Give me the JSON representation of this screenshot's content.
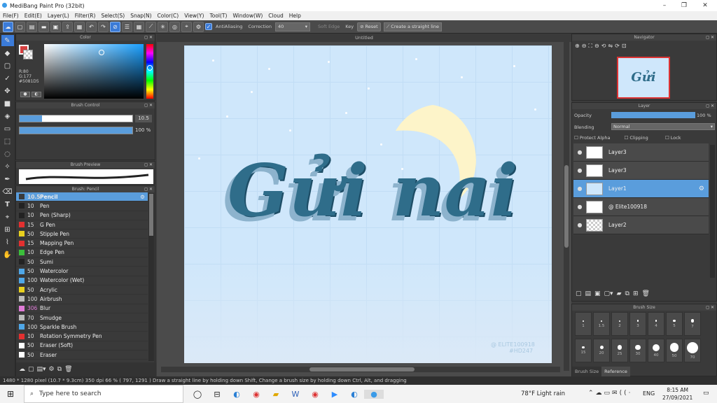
{
  "window": {
    "title": "MediBang Paint Pro (32bit)",
    "minimize": "–",
    "maximize": "❐",
    "close": "✕"
  },
  "menu": [
    "File(F)",
    "Edit(E)",
    "Layer(L)",
    "Filter(R)",
    "Select(S)",
    "Snap(N)",
    "Color(C)",
    "View(Y)",
    "Tool(T)",
    "Window(W)",
    "Cloud",
    "Help"
  ],
  "toolbar": {
    "antialiasing": "AntiAliasing",
    "correction_label": "Correction",
    "correction_value": "40",
    "soft_edge": "Soft Edge",
    "key": "Key",
    "reset": "Reset",
    "straight_line": "Create a straight line"
  },
  "color_panel": {
    "title": "Color",
    "r": "R:80",
    "g": "G:177",
    "b": "B:...",
    "hex": "#5081D5"
  },
  "brush_control": {
    "title": "Brush Control",
    "size": "10.5",
    "opacity": "100 %"
  },
  "brush_preview": {
    "title": "Brush Preview"
  },
  "brush_panel": {
    "title": "Brush: Pencil",
    "items": [
      {
        "size": "10.5",
        "name": "Pencil",
        "color": "#3b3b3b"
      },
      {
        "size": "10",
        "name": "Pen",
        "color": "#222222"
      },
      {
        "size": "10",
        "name": "Pen (Sharp)",
        "color": "#222222"
      },
      {
        "size": "15",
        "name": "G Pen",
        "color": "#e33030"
      },
      {
        "size": "50",
        "name": "Stipple Pen",
        "color": "#e8d01e"
      },
      {
        "size": "15",
        "name": "Mapping Pen",
        "color": "#e33030"
      },
      {
        "size": "10",
        "name": "Edge Pen",
        "color": "#3bbf3b"
      },
      {
        "size": "50",
        "name": "Sumi",
        "color": "#222222"
      },
      {
        "size": "50",
        "name": "Watercolor",
        "color": "#4fa7e8"
      },
      {
        "size": "100",
        "name": "Watercolor (Wet)",
        "color": "#4fa7e8"
      },
      {
        "size": "50",
        "name": "Acrylic",
        "color": "#e8d01e"
      },
      {
        "size": "100",
        "name": "Airbrush",
        "color": "#bbbbbb"
      },
      {
        "size": "306",
        "name": "Blur",
        "color": "#e07bd8"
      },
      {
        "size": "70",
        "name": "Smudge",
        "color": "#bbbbbb"
      },
      {
        "size": "100",
        "name": "Sparkle Brush",
        "color": "#4fa7e8"
      },
      {
        "size": "10",
        "name": "Rotation Symmetry Pen",
        "color": "#e33030"
      },
      {
        "size": "50",
        "name": "Eraser (Soft)",
        "color": "#ffffff"
      },
      {
        "size": "50",
        "name": "Eraser",
        "color": "#ffffff"
      }
    ]
  },
  "canvas": {
    "tab": "Untitled",
    "art_text": "Gửi nai",
    "watermark_1": "@ ELITE100918",
    "watermark_2": "#HD247"
  },
  "navigator": {
    "title": "Navigator",
    "thumb_text": "Gửi nai"
  },
  "layer_panel": {
    "title": "Layer",
    "opacity_label": "Opacity",
    "opacity_value": "100 %",
    "opacity_fraction": 1.0,
    "blending_label": "Blending",
    "blending_value": "Normal",
    "protect_alpha": "Protect Alpha",
    "clipping": "Clipping",
    "lock": "Lock",
    "layers": [
      {
        "name": "Layer3",
        "selected": false
      },
      {
        "name": "Layer3",
        "selected": false
      },
      {
        "name": "Layer1",
        "selected": true
      },
      {
        "name": "@ Elite100918",
        "selected": false
      },
      {
        "name": "Layer2",
        "selected": false
      }
    ]
  },
  "brush_size": {
    "title": "Brush Size",
    "sizes_row1": [
      "1",
      "1.5",
      "2",
      "3",
      "4",
      "5",
      "7"
    ],
    "sizes_row2": [
      "15",
      "20",
      "25",
      "30",
      "40",
      "50",
      "70"
    ],
    "tabs": [
      "Brush Size",
      "Reference"
    ]
  },
  "status": {
    "text": "1480 * 1280 pixel  (10.7 * 9.3cm)  350 dpi  66 %  ( 797, 1291 )  Draw a straight line by holding down Shift, Change a brush size by holding down Ctrl, Alt, and dragging"
  },
  "taskbar": {
    "search_placeholder": "Type here to search",
    "weather": "78°F  Light rain",
    "lang": "ENG",
    "time": "8:15 AM",
    "date": "27/09/2021"
  }
}
